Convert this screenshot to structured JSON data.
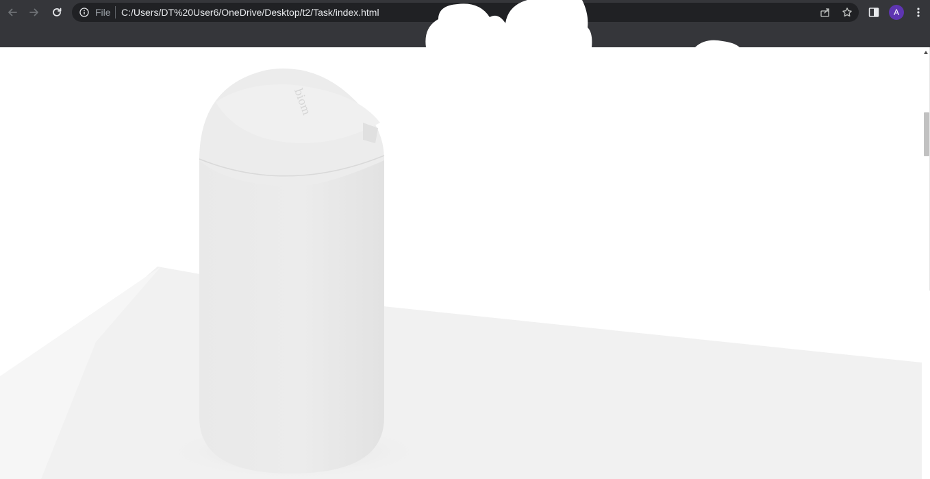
{
  "browser": {
    "url_scheme_label": "File",
    "url": "C:/Users/DT%20User6/OneDrive/Desktop/t2/Task/index.html",
    "profile_initial": "A",
    "icons": {
      "back": "arrow-left-icon",
      "forward": "arrow-right-icon",
      "reload": "reload-icon",
      "site_info": "info-icon",
      "share": "share-icon",
      "bookmark": "star-icon",
      "side_panel": "side-panel-icon",
      "menu": "kebab-menu-icon"
    },
    "colors": {
      "chrome_bg": "#35363a",
      "omnibox_bg": "#202124",
      "avatar_bg": "#5e35b1"
    }
  },
  "page": {
    "product_logo_text": "biom",
    "vertical_brand_text": "biom",
    "product_color": "#ebebeb",
    "background_color": "#ffffff",
    "table_color": "#f1f1f1"
  }
}
